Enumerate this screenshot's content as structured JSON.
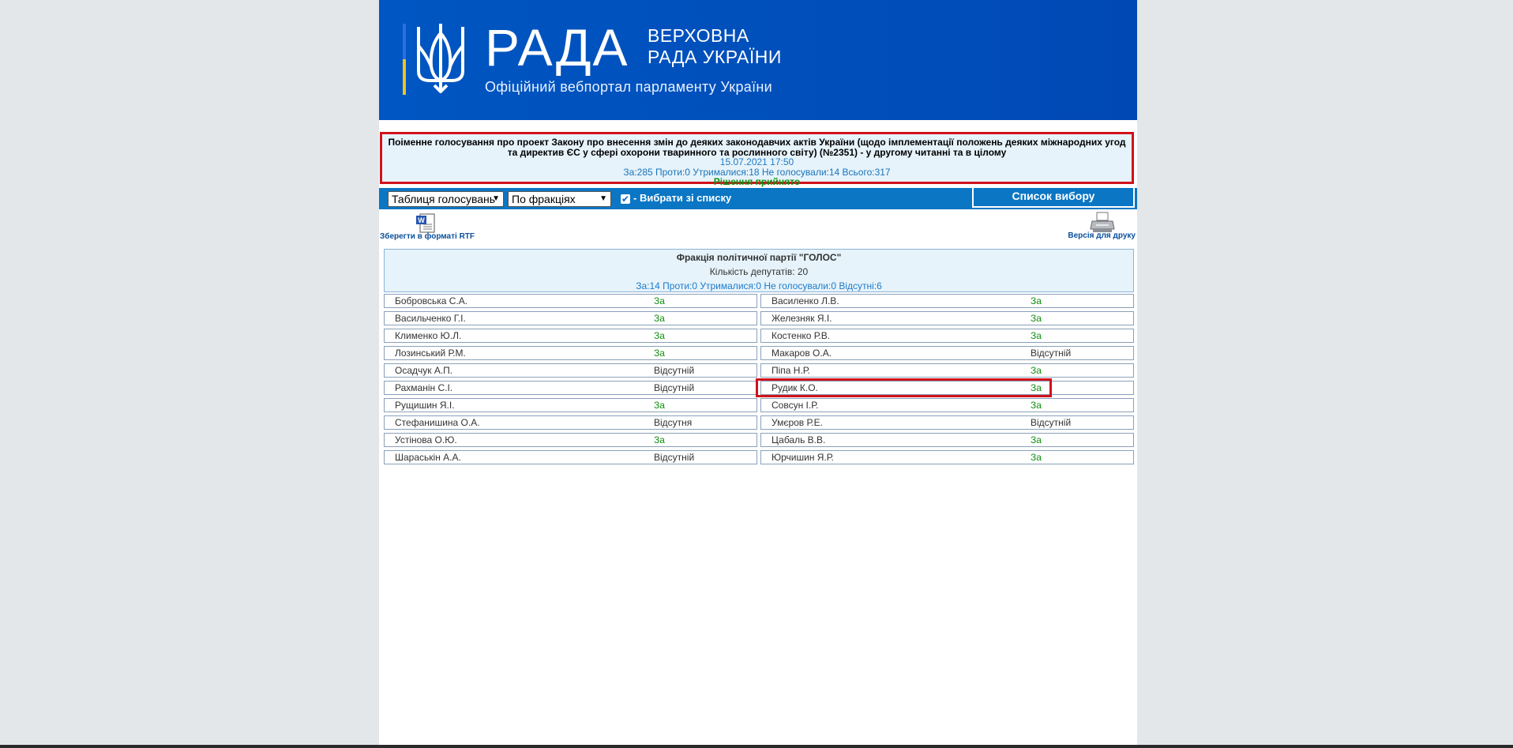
{
  "header": {
    "logo_big": "РАДА",
    "logo_line1": "ВЕРХОВНА",
    "logo_line2": "РАДА УКРАЇНИ",
    "tagline": "Офіційний вебпортал парламенту України"
  },
  "vote": {
    "title": "Поіменне голосування про проект Закону про внесення змін до деяких законодавчих актів України (щодо імплементації положень деяких міжнародних угод та директив ЄС у сфері охорони тваринного та рослинного світу) (№2351) - у другому читанні та в цілому",
    "datetime": "15.07.2021 17:50",
    "counts": "За:285 Проти:0 Утрималися:18 Не голосували:14 Всього:317",
    "result": "Рішення прийнято"
  },
  "toolbar": {
    "view_select": "Таблиця голосувань",
    "group_select": "По фракціях",
    "choose_from_list": "- Вибрати зі списку",
    "list_button": "Список вибору"
  },
  "tools": {
    "save_rtf": "Зберегти в форматі RTF",
    "print_version": "Версія для друку"
  },
  "faction": {
    "name": "Фракція політичної партії \"ГОЛОС\"",
    "count": "Кількість депутатів: 20",
    "stats": "За:14 Проти:0 Утрималися:0 Не голосували:0 Відсутні:6"
  },
  "deputies_left": [
    {
      "name": "Бобровська С.А.",
      "result": "За"
    },
    {
      "name": "Васильченко Г.І.",
      "result": "За"
    },
    {
      "name": "Клименко Ю.Л.",
      "result": "За"
    },
    {
      "name": "Лозинський Р.М.",
      "result": "За"
    },
    {
      "name": "Осадчук А.П.",
      "result": "Відсутній"
    },
    {
      "name": "Рахманін С.І.",
      "result": "Відсутній"
    },
    {
      "name": "Рущишин Я.І.",
      "result": "За"
    },
    {
      "name": "Стефанишина О.А.",
      "result": "Відсутня"
    },
    {
      "name": "Устінова О.Ю.",
      "result": "За"
    },
    {
      "name": "Шараськін А.А.",
      "result": "Відсутній"
    }
  ],
  "deputies_right": [
    {
      "name": "Василенко Л.В.",
      "result": "За"
    },
    {
      "name": "Железняк Я.І.",
      "result": "За"
    },
    {
      "name": "Костенко Р.В.",
      "result": "За"
    },
    {
      "name": "Макаров О.А.",
      "result": "Відсутній"
    },
    {
      "name": "Піпа Н.Р.",
      "result": "За"
    },
    {
      "name": "Рудик К.О.",
      "result": "За"
    },
    {
      "name": "Совсун І.Р.",
      "result": "За"
    },
    {
      "name": "Умєров Р.Е.",
      "result": "Відсутній"
    },
    {
      "name": "Цабаль В.В.",
      "result": "За"
    },
    {
      "name": "Юрчишин Я.Р.",
      "result": "За"
    }
  ],
  "colors": {
    "header_blue": "#0050bd",
    "toolbar_blue": "#0a76c4",
    "highlight_red": "#d0121b",
    "vote_for_green": "#109010"
  }
}
